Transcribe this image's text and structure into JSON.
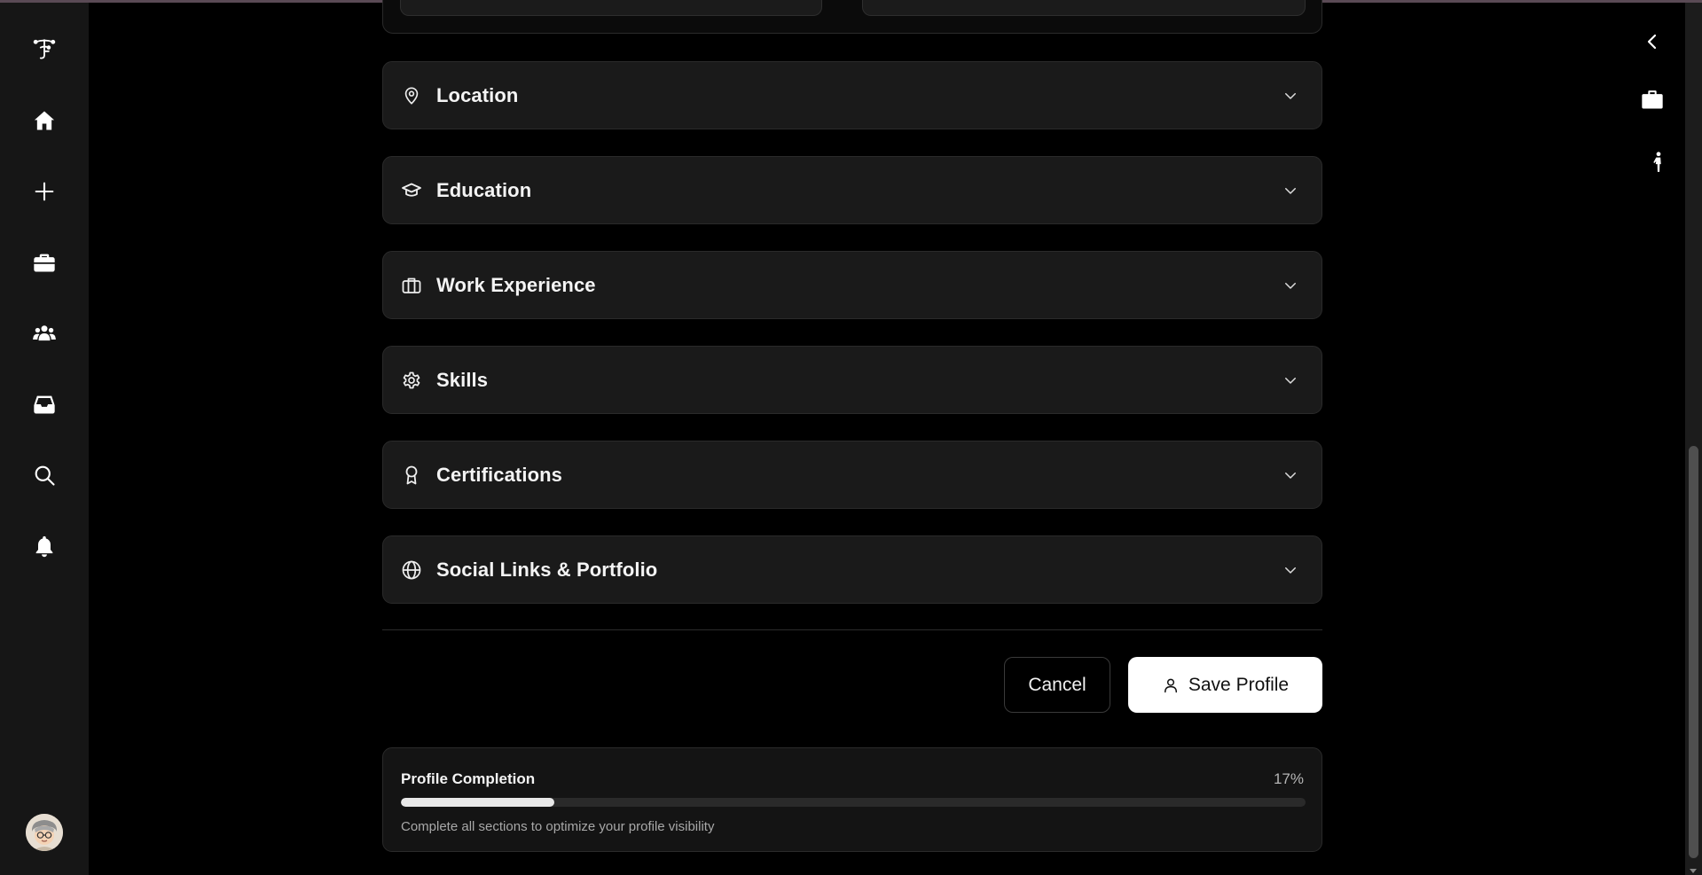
{
  "sections": [
    {
      "title": "Location",
      "icon": "map-pin-icon"
    },
    {
      "title": "Education",
      "icon": "graduation-cap-icon"
    },
    {
      "title": "Work Experience",
      "icon": "briefcase-icon"
    },
    {
      "title": "Skills",
      "icon": "gear-icon"
    },
    {
      "title": "Certifications",
      "icon": "award-icon"
    },
    {
      "title": "Social Links & Portfolio",
      "icon": "globe-icon"
    }
  ],
  "actions": {
    "cancel_label": "Cancel",
    "save_label": "Save Profile"
  },
  "completion": {
    "title": "Profile Completion",
    "percent_label": "17%",
    "percent_value": 0.17,
    "note": "Complete all sections to optimize your profile visibility"
  },
  "left_nav": [
    "logo-icon",
    "home-icon",
    "plus-icon",
    "briefcase-icon",
    "people-icon",
    "inbox-icon",
    "search-icon",
    "bell-icon",
    "avatar"
  ],
  "right_nav": [
    "chevron-left-icon",
    "briefcase-icon",
    "person-walking-icon"
  ],
  "colors": {
    "background": "#000000",
    "sidebar": "#161616",
    "card": "#1a1a1a",
    "accent_button": "#ffffff",
    "progress_fill": "#e8e8e8"
  }
}
